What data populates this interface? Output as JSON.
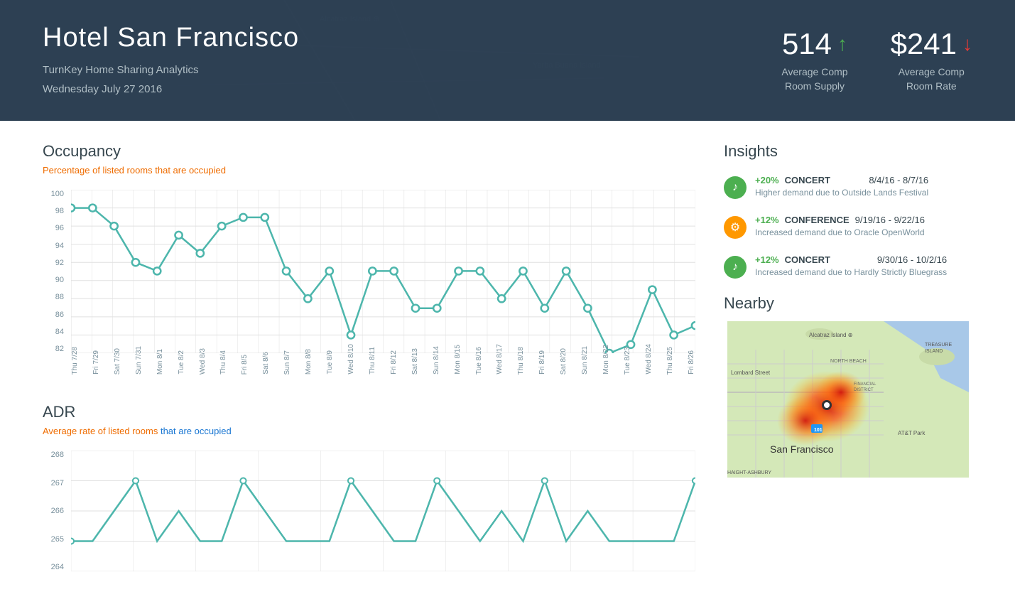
{
  "header": {
    "hotel_name": "Hotel San Francisco",
    "subtitle_line1": "TurnKey Home Sharing Analytics",
    "subtitle_line2": "Wednesday July 27 2016",
    "stats": [
      {
        "value": "514",
        "trend": "up",
        "label_line1": "Average Comp",
        "label_line2": "Room Supply"
      },
      {
        "value": "$241",
        "trend": "down",
        "label_line1": "Average Comp",
        "label_line2": "Room Rate"
      }
    ]
  },
  "occupancy": {
    "title": "Occupancy",
    "subtitle": "Percentage of listed rooms that are occupied",
    "y_labels": [
      "100",
      "98",
      "96",
      "94",
      "92",
      "90",
      "88",
      "86",
      "84",
      "82"
    ],
    "x_labels": [
      "Thu 7/28",
      "Fri 7/29",
      "Sat 7/30",
      "Sun 7/31",
      "Mon 8/1",
      "Tue 8/2",
      "Wed 8/3",
      "Thu 8/4",
      "Fri 8/5",
      "Sat 8/6",
      "Sun 8/7",
      "Mon 8/8",
      "Tue 8/9",
      "Wed 8/10",
      "Thu 8/11",
      "Fri 8/12",
      "Sat 8/13",
      "Sun 8/14",
      "Mon 8/15",
      "Tue 8/16",
      "Wed 8/17",
      "Thu 8/18",
      "Fri 8/19",
      "Sat 8/20",
      "Sun 8/21",
      "Mon 8/22",
      "Tue 8/23",
      "Wed 8/24",
      "Thu 8/25",
      "Fri 8/26"
    ]
  },
  "adr": {
    "title": "ADR",
    "subtitle_start": "Average rate of listed rooms ",
    "subtitle_link": "that are occupied",
    "y_labels": [
      "268",
      "267",
      "266",
      "265",
      "264"
    ]
  },
  "insights": {
    "title": "Insights",
    "items": [
      {
        "type": "green",
        "pct": "+20%",
        "category": "CONCERT",
        "date": "8/4/16 - 8/7/16",
        "desc_start": "Higher demand due to Outside Lands Festival",
        "desc_link": ""
      },
      {
        "type": "orange",
        "pct": "+12%",
        "category": "CONFERENCE",
        "date": "9/19/16 - 9/22/16",
        "desc_start": "Increased demand due to Oracle OpenWorld",
        "desc_link": ""
      },
      {
        "type": "green",
        "pct": "+12%",
        "category": "CONCERT",
        "date": "9/30/16 - 10/2/16",
        "desc_start": "Increased demand due to Hardly Strictly Bluegrass",
        "desc_link": ""
      }
    ]
  },
  "nearby": {
    "title": "Nearby"
  }
}
